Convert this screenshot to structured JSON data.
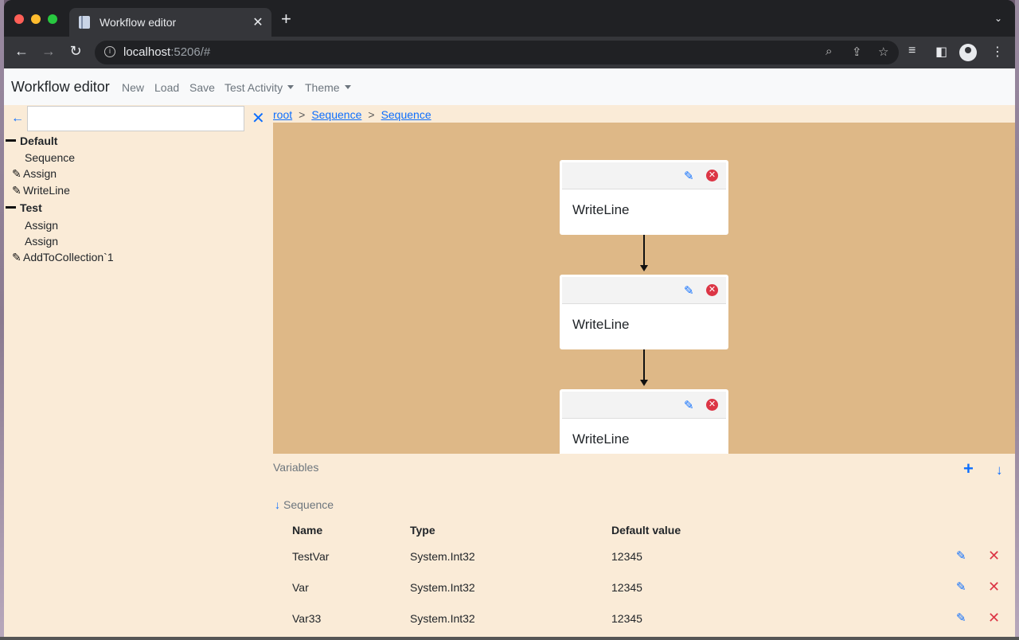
{
  "browser": {
    "tab_title": "Workflow editor",
    "url_host": "localhost",
    "url_rest": ":5206/#"
  },
  "navbar": {
    "brand": "Workflow editor",
    "items": [
      "New",
      "Load",
      "Save",
      "Test Activity",
      "Theme"
    ]
  },
  "sidebar": {
    "search_value": "",
    "groups": [
      {
        "label": "Default",
        "items": [
          {
            "label": "Sequence",
            "editable": false
          },
          {
            "label": "Assign",
            "editable": true
          },
          {
            "label": "WriteLine",
            "editable": true
          }
        ]
      },
      {
        "label": "Test",
        "items": [
          {
            "label": "Assign",
            "editable": false
          },
          {
            "label": "Assign",
            "editable": false
          },
          {
            "label": "AddToCollection`1",
            "editable": true
          }
        ]
      }
    ]
  },
  "breadcrumb": [
    "root",
    "Sequence",
    "Sequence"
  ],
  "breadcrumb_sep": ">",
  "canvas": {
    "nodes": [
      {
        "title": "WriteLine"
      },
      {
        "title": "WriteLine"
      },
      {
        "title": "WriteLine"
      }
    ]
  },
  "variables": {
    "label": "Variables",
    "scope": "Sequence",
    "headers": [
      "Name",
      "Type",
      "Default value"
    ],
    "rows": [
      {
        "name": "TestVar",
        "type": "System.Int32",
        "default": "12345"
      },
      {
        "name": "Var",
        "type": "System.Int32",
        "default": "12345"
      },
      {
        "name": "Var33",
        "type": "System.Int32",
        "default": "12345"
      }
    ]
  },
  "colors": {
    "page_bg": "#faebd7",
    "canvas_bg": "#deb887",
    "accent": "#0d6efd",
    "danger": "#dc3545"
  }
}
